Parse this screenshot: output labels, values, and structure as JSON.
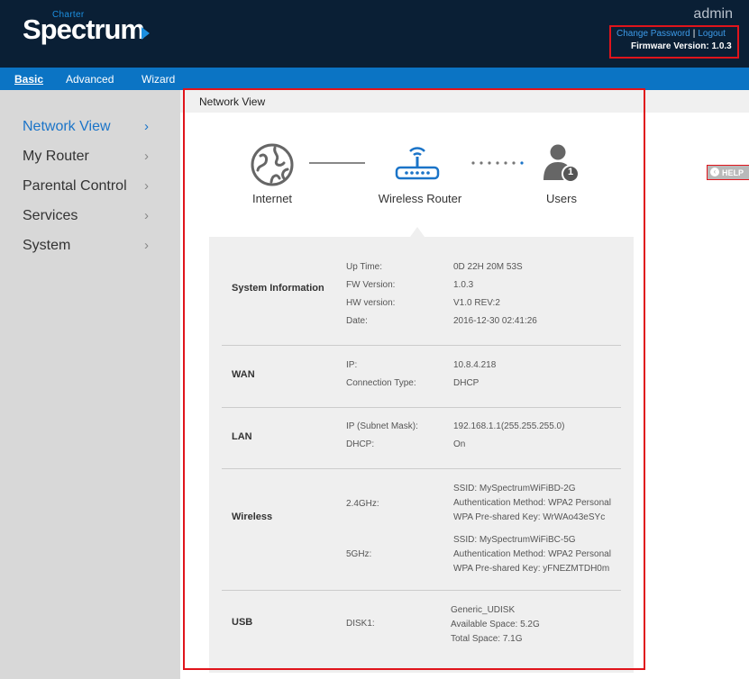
{
  "brand": {
    "charter": "Charter",
    "spectrum": "Spectrum",
    "accent_color": "#1c8fe0"
  },
  "header": {
    "user": "admin",
    "change_password": "Change Password",
    "separator": "|",
    "logout": "Logout",
    "firmware": "Firmware Version: 1.0.3"
  },
  "nav": {
    "tabs": [
      "Basic",
      "Advanced",
      "Wizard"
    ],
    "active": "Basic"
  },
  "sidebar": {
    "items": [
      {
        "label": "Network View",
        "active": true
      },
      {
        "label": "My Router"
      },
      {
        "label": "Parental Control"
      },
      {
        "label": "Services"
      },
      {
        "label": "System"
      }
    ],
    "chevron": "›"
  },
  "page": {
    "title": "Network View"
  },
  "network": {
    "internet": "Internet",
    "router": "Wireless Router",
    "users": "Users",
    "user_count": "1"
  },
  "help": "HELP",
  "info": {
    "system": {
      "title": "System Information",
      "uptime_label": "Up Time:",
      "uptime": "0D 22H 20M 53S",
      "fw_label": "FW Version:",
      "fw": "1.0.3",
      "hw_label": "HW version:",
      "hw": "V1.0 REV:2",
      "date_label": "Date:",
      "date": "2016-12-30 02:41:26"
    },
    "wan": {
      "title": "WAN",
      "ip_label": "IP:",
      "ip": "10.8.4.218",
      "conn_label": "Connection Type:",
      "conn": "DHCP"
    },
    "lan": {
      "title": "LAN",
      "ip_label": "IP (Subnet Mask):",
      "ip": "192.168.1.1(255.255.255.0)",
      "dhcp_label": "DHCP:",
      "dhcp": "On"
    },
    "wireless": {
      "title": "Wireless",
      "band24_label": "2.4GHz:",
      "band24_ssid": "SSID: MySpectrumWiFiBD-2G",
      "band24_auth": "Authentication Method: WPA2 Personal",
      "band24_key": "WPA Pre-shared Key: WrWAo43eSYc",
      "band5_label": "5GHz:",
      "band5_ssid": "SSID: MySpectrumWiFiBC-5G",
      "band5_auth": "Authentication Method: WPA2 Personal",
      "band5_key": "WPA Pre-shared Key: yFNEZMTDH0m"
    },
    "usb": {
      "title": "USB",
      "disk_label": "DISK1:",
      "disk_name": "Generic_UDISK",
      "avail": "Available Space: 5.2G",
      "total": "Total Space: 7.1G"
    }
  }
}
